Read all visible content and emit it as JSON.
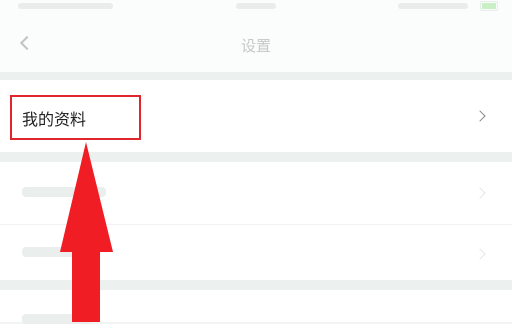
{
  "statusBar": {
    "batteryIcon": "battery-icon"
  },
  "nav": {
    "backIcon": "back-arrow-icon",
    "title": "设置"
  },
  "rows": [
    {
      "label": "我的资料",
      "icon": "chevron-right-icon"
    }
  ],
  "annotation": {
    "boxColor": "#e0262c",
    "arrowColor": "#f01e24",
    "arrowIcon": "red-up-arrow"
  }
}
